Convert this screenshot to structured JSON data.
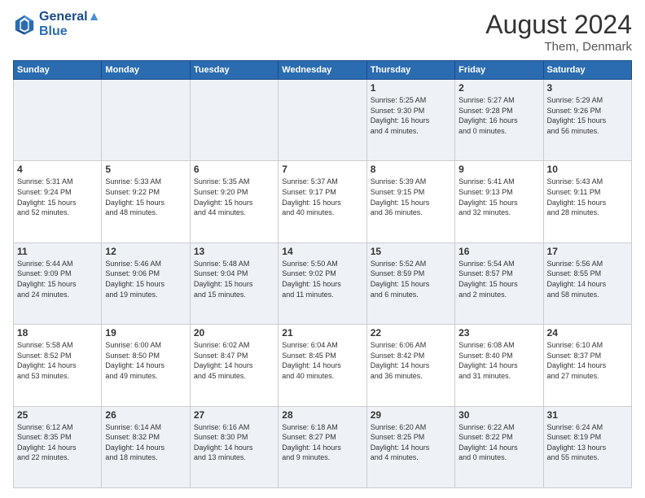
{
  "header": {
    "logo_line1": "General",
    "logo_line2": "Blue",
    "month_year": "August 2024",
    "location": "Them, Denmark"
  },
  "days_of_week": [
    "Sunday",
    "Monday",
    "Tuesday",
    "Wednesday",
    "Thursday",
    "Friday",
    "Saturday"
  ],
  "weeks": [
    [
      {
        "day": "",
        "info": ""
      },
      {
        "day": "",
        "info": ""
      },
      {
        "day": "",
        "info": ""
      },
      {
        "day": "",
        "info": ""
      },
      {
        "day": "1",
        "info": "Sunrise: 5:25 AM\nSunset: 9:30 PM\nDaylight: 16 hours\nand 4 minutes."
      },
      {
        "day": "2",
        "info": "Sunrise: 5:27 AM\nSunset: 9:28 PM\nDaylight: 16 hours\nand 0 minutes."
      },
      {
        "day": "3",
        "info": "Sunrise: 5:29 AM\nSunset: 9:26 PM\nDaylight: 15 hours\nand 56 minutes."
      }
    ],
    [
      {
        "day": "4",
        "info": "Sunrise: 5:31 AM\nSunset: 9:24 PM\nDaylight: 15 hours\nand 52 minutes."
      },
      {
        "day": "5",
        "info": "Sunrise: 5:33 AM\nSunset: 9:22 PM\nDaylight: 15 hours\nand 48 minutes."
      },
      {
        "day": "6",
        "info": "Sunrise: 5:35 AM\nSunset: 9:20 PM\nDaylight: 15 hours\nand 44 minutes."
      },
      {
        "day": "7",
        "info": "Sunrise: 5:37 AM\nSunset: 9:17 PM\nDaylight: 15 hours\nand 40 minutes."
      },
      {
        "day": "8",
        "info": "Sunrise: 5:39 AM\nSunset: 9:15 PM\nDaylight: 15 hours\nand 36 minutes."
      },
      {
        "day": "9",
        "info": "Sunrise: 5:41 AM\nSunset: 9:13 PM\nDaylight: 15 hours\nand 32 minutes."
      },
      {
        "day": "10",
        "info": "Sunrise: 5:43 AM\nSunset: 9:11 PM\nDaylight: 15 hours\nand 28 minutes."
      }
    ],
    [
      {
        "day": "11",
        "info": "Sunrise: 5:44 AM\nSunset: 9:09 PM\nDaylight: 15 hours\nand 24 minutes."
      },
      {
        "day": "12",
        "info": "Sunrise: 5:46 AM\nSunset: 9:06 PM\nDaylight: 15 hours\nand 19 minutes."
      },
      {
        "day": "13",
        "info": "Sunrise: 5:48 AM\nSunset: 9:04 PM\nDaylight: 15 hours\nand 15 minutes."
      },
      {
        "day": "14",
        "info": "Sunrise: 5:50 AM\nSunset: 9:02 PM\nDaylight: 15 hours\nand 11 minutes."
      },
      {
        "day": "15",
        "info": "Sunrise: 5:52 AM\nSunset: 8:59 PM\nDaylight: 15 hours\nand 6 minutes."
      },
      {
        "day": "16",
        "info": "Sunrise: 5:54 AM\nSunset: 8:57 PM\nDaylight: 15 hours\nand 2 minutes."
      },
      {
        "day": "17",
        "info": "Sunrise: 5:56 AM\nSunset: 8:55 PM\nDaylight: 14 hours\nand 58 minutes."
      }
    ],
    [
      {
        "day": "18",
        "info": "Sunrise: 5:58 AM\nSunset: 8:52 PM\nDaylight: 14 hours\nand 53 minutes."
      },
      {
        "day": "19",
        "info": "Sunrise: 6:00 AM\nSunset: 8:50 PM\nDaylight: 14 hours\nand 49 minutes."
      },
      {
        "day": "20",
        "info": "Sunrise: 6:02 AM\nSunset: 8:47 PM\nDaylight: 14 hours\nand 45 minutes."
      },
      {
        "day": "21",
        "info": "Sunrise: 6:04 AM\nSunset: 8:45 PM\nDaylight: 14 hours\nand 40 minutes."
      },
      {
        "day": "22",
        "info": "Sunrise: 6:06 AM\nSunset: 8:42 PM\nDaylight: 14 hours\nand 36 minutes."
      },
      {
        "day": "23",
        "info": "Sunrise: 6:08 AM\nSunset: 8:40 PM\nDaylight: 14 hours\nand 31 minutes."
      },
      {
        "day": "24",
        "info": "Sunrise: 6:10 AM\nSunset: 8:37 PM\nDaylight: 14 hours\nand 27 minutes."
      }
    ],
    [
      {
        "day": "25",
        "info": "Sunrise: 6:12 AM\nSunset: 8:35 PM\nDaylight: 14 hours\nand 22 minutes."
      },
      {
        "day": "26",
        "info": "Sunrise: 6:14 AM\nSunset: 8:32 PM\nDaylight: 14 hours\nand 18 minutes."
      },
      {
        "day": "27",
        "info": "Sunrise: 6:16 AM\nSunset: 8:30 PM\nDaylight: 14 hours\nand 13 minutes."
      },
      {
        "day": "28",
        "info": "Sunrise: 6:18 AM\nSunset: 8:27 PM\nDaylight: 14 hours\nand 9 minutes."
      },
      {
        "day": "29",
        "info": "Sunrise: 6:20 AM\nSunset: 8:25 PM\nDaylight: 14 hours\nand 4 minutes."
      },
      {
        "day": "30",
        "info": "Sunrise: 6:22 AM\nSunset: 8:22 PM\nDaylight: 14 hours\nand 0 minutes."
      },
      {
        "day": "31",
        "info": "Sunrise: 6:24 AM\nSunset: 8:19 PM\nDaylight: 13 hours\nand 55 minutes."
      }
    ]
  ]
}
